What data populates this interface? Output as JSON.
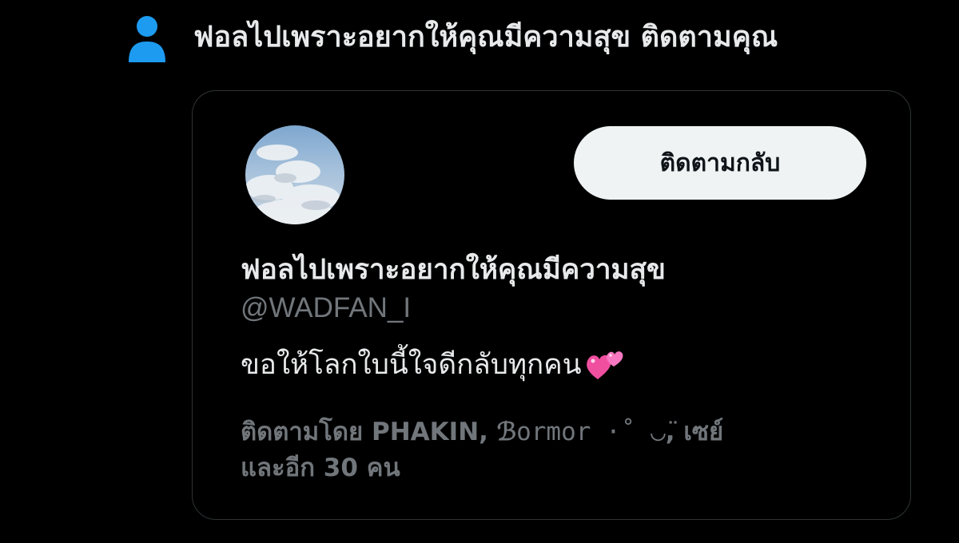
{
  "notice": {
    "text": "ฟอลไปเพราะอยากให้คุณมีความสุข ติดตามคุณ",
    "icon": "person-icon",
    "icon_color": "#1d9bf0"
  },
  "card": {
    "avatar": "avatar",
    "follow_back_label": "ติดตามกลับ",
    "display_name": "ฟอลไปเพราะอยากให้คุณมีความสุข",
    "handle": "@WADFAN_I",
    "bio": "ขอให้โลกใบนี้ใจดีกลับทุกคน",
    "bio_icon": "two-hearts-icon",
    "followed_by": {
      "prefix": "ติดตามโดย",
      "user1": "PHAKIN",
      "user2_initial": "ℬ",
      "user2_rest": "ormor ·˚ ◡̈",
      "user3": "เซย์",
      "suffix": "และอีก 30 คน"
    }
  }
}
